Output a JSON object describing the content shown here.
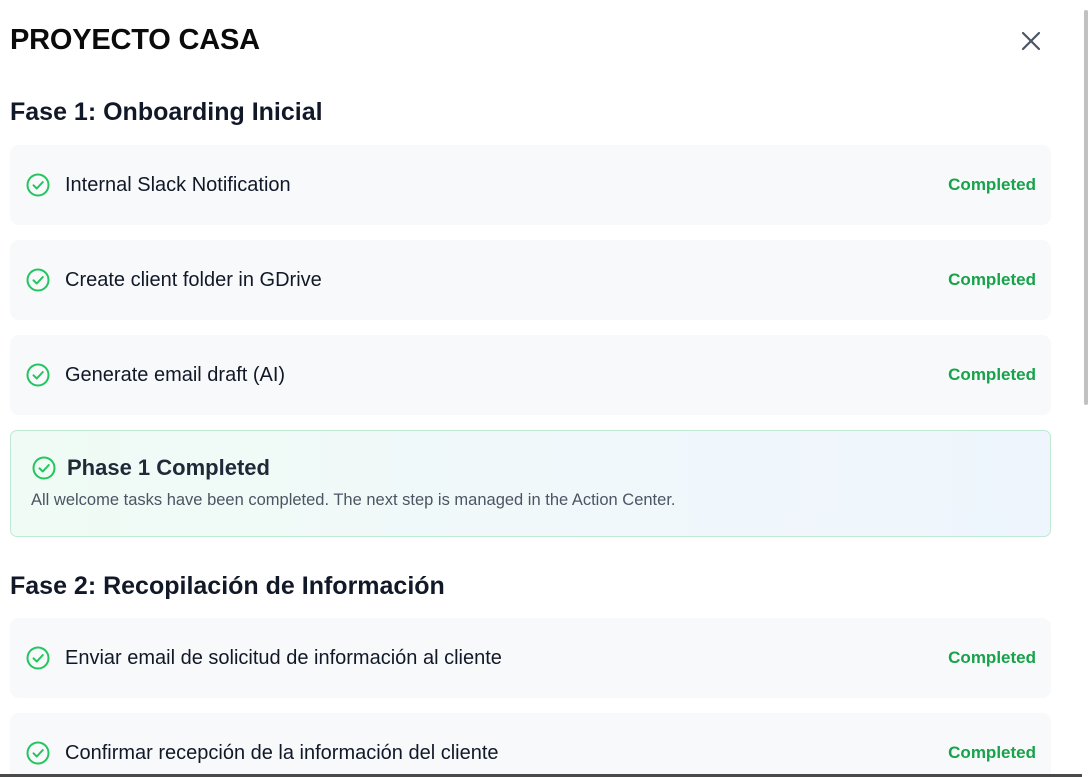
{
  "modal": {
    "title": "PROYECTO CASA",
    "close_icon": "close-icon"
  },
  "phases": [
    {
      "title": "Fase 1: Onboarding Inicial",
      "tasks": [
        {
          "label": "Internal Slack Notification",
          "status": "Completed"
        },
        {
          "label": "Create client folder in GDrive",
          "status": "Completed"
        },
        {
          "label": "Generate email draft (AI)",
          "status": "Completed"
        }
      ],
      "banner": {
        "title": "Phase 1 Completed",
        "text": "All welcome tasks have been completed. The next step is managed in the Action Center."
      }
    },
    {
      "title": "Fase 2: Recopilación de Información",
      "tasks": [
        {
          "label": "Enviar email de solicitud de información al cliente",
          "status": "Completed"
        },
        {
          "label": "Confirmar recepción de la información del cliente",
          "status": "Completed"
        }
      ]
    }
  ],
  "colors": {
    "success": "#16a34a",
    "check_icon": "#22c55e"
  }
}
